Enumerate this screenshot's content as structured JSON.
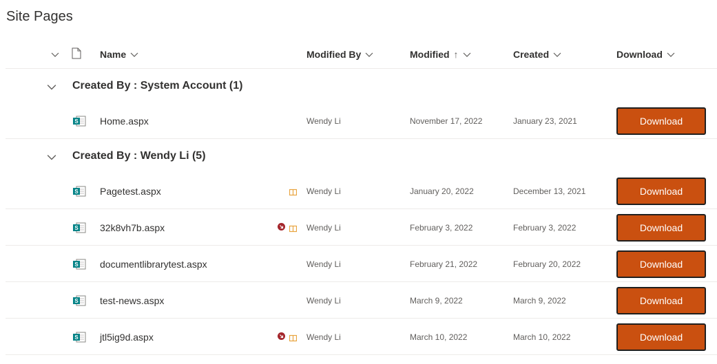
{
  "page": {
    "title": "Site Pages"
  },
  "columns": {
    "name": "Name",
    "modified_by": "Modified By",
    "modified": "Modified",
    "modified_sort": "↑",
    "created": "Created",
    "download": "Download"
  },
  "groups": [
    {
      "label": "Created By : System Account (1)",
      "rows": [
        {
          "name": "Home.aspx",
          "modified_by": "Wendy Li",
          "modified": "November 17, 2022",
          "created": "January 23, 2021",
          "download": "Download",
          "status": []
        }
      ]
    },
    {
      "label": "Created By : Wendy Li (5)",
      "rows": [
        {
          "name": "Pagetest.aspx",
          "modified_by": "Wendy Li",
          "modified": "January 20, 2022",
          "created": "December 13, 2021",
          "download": "Download",
          "status": [
            "book"
          ]
        },
        {
          "name": "32k8vh7b.aspx",
          "modified_by": "Wendy Li",
          "modified": "February 3, 2022",
          "created": "February 3, 2022",
          "download": "Download",
          "status": [
            "alert",
            "book"
          ]
        },
        {
          "name": "documentlibrarytest.aspx",
          "modified_by": "Wendy Li",
          "modified": "February 21, 2022",
          "created": "February 20, 2022",
          "download": "Download",
          "status": []
        },
        {
          "name": "test-news.aspx",
          "modified_by": "Wendy Li",
          "modified": "March 9, 2022",
          "created": "March 9, 2022",
          "download": "Download",
          "status": []
        },
        {
          "name": "jtl5ig9d.aspx",
          "modified_by": "Wendy Li",
          "modified": "March 10, 2022",
          "created": "March 10, 2022",
          "download": "Download",
          "status": [
            "alert",
            "book"
          ]
        }
      ]
    }
  ],
  "icons": {
    "file_type": "sharepoint-page-icon",
    "alert": "alert-icon",
    "book": "book-icon",
    "chevron": "chevron-down-icon"
  },
  "colors": {
    "accent": "#ca5010",
    "sharepoint": "#038387",
    "alert": "#a4262c",
    "book": "#e8a33d"
  }
}
